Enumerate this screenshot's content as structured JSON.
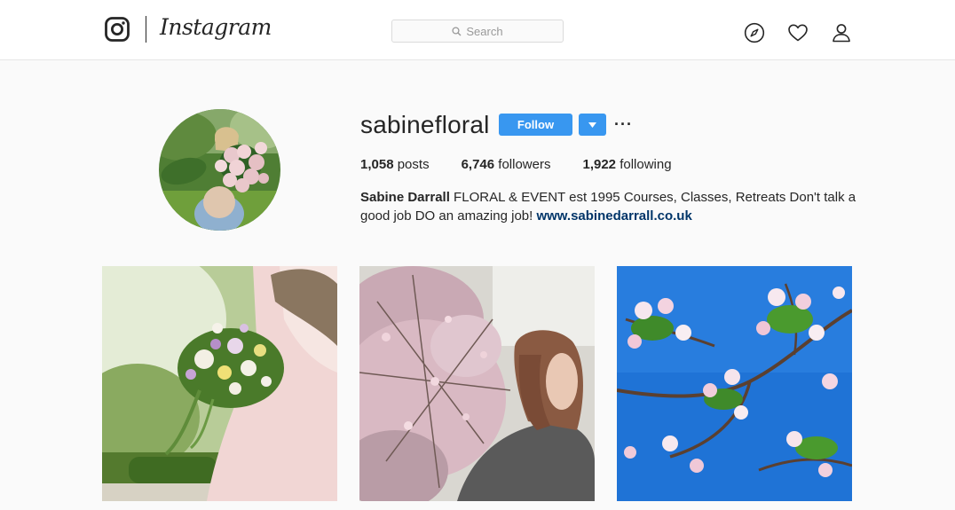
{
  "header": {
    "logo_icon": "instagram-camera-icon",
    "wordmark": "Instagram",
    "search_placeholder": "Search",
    "nav_icons": [
      "compass-icon",
      "heart-icon",
      "person-icon"
    ]
  },
  "profile": {
    "username": "sabinefloral",
    "follow_label": "Follow",
    "more_label": "···",
    "stats": [
      {
        "count": "1,058",
        "label": " posts"
      },
      {
        "count": "6,746",
        "label": " followers"
      },
      {
        "count": "1,922",
        "label": " following"
      }
    ],
    "bio": {
      "name": "Sabine Darrall",
      "text": " FLORAL & EVENT est 1995 Courses, Classes, Retreats Don't talk a good job DO an amazing job! ",
      "link": "www.sabinedarrall.co.uk"
    }
  },
  "colors": {
    "accent": "#3897f0",
    "link": "#003569",
    "text": "#262626",
    "background": "#fafafa"
  }
}
